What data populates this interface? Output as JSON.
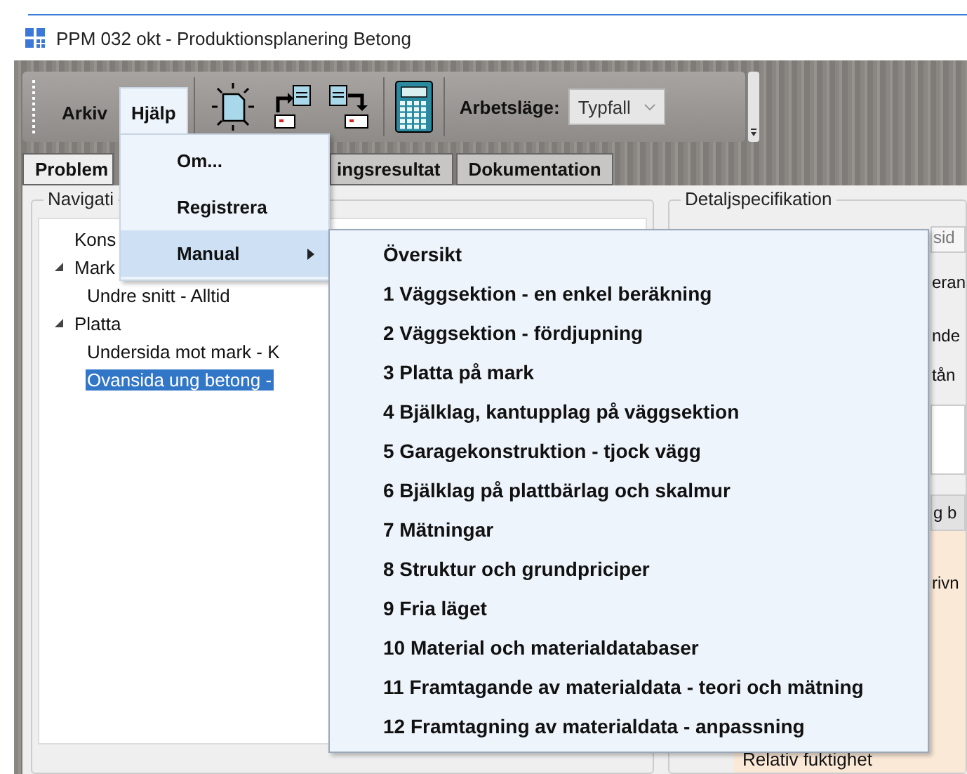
{
  "window": {
    "title": "PPM 032 okt - Produktionsplanering Betong"
  },
  "menubar": [
    {
      "label": "Arkiv",
      "open": false
    },
    {
      "label": "Hjälp",
      "open": true
    }
  ],
  "toolbar": {
    "mode_label": "Arbetsläge:",
    "mode_value": "Typfall",
    "mode_disabled": true
  },
  "tabs": [
    {
      "label": "Problem",
      "selected": true
    },
    {
      "label": "ingsresultat",
      "selected": false
    },
    {
      "label": "Dokumentation",
      "selected": false
    }
  ],
  "navigation": {
    "title": "Navigati",
    "tree": [
      {
        "label": "Kons",
        "selected": false
      },
      {
        "label": "Mark",
        "selected": false,
        "expanded": true,
        "children": [
          {
            "label": "Undre snitt - Alltid",
            "selected": false
          }
        ]
      },
      {
        "label": "Platta",
        "selected": false,
        "expanded": true,
        "children": [
          {
            "label": "Undersida mot mark - K",
            "selected": false
          },
          {
            "label": "Ovansida ung betong -",
            "selected": true
          }
        ]
      }
    ]
  },
  "help_menu": [
    {
      "label": "Om...",
      "selected": false,
      "has_submenu": false
    },
    {
      "label": "Registrera",
      "selected": false,
      "has_submenu": false
    },
    {
      "label": "Manual",
      "selected": true,
      "has_submenu": true
    }
  ],
  "manual_submenu": [
    "Översikt",
    "1 Väggsektion - en enkel beräkning",
    "2 Väggsektion - fördjupning",
    "3 Platta på mark",
    "4 Bjälklag, kantupplag på väggsektion",
    "5 Garagekonstruktion - tjock vägg",
    "6 Bjälklag på plattbärlag och skalmur",
    "7 Mätningar",
    "8 Struktur och grundpriciper",
    "9 Fria läget",
    "10 Material och materialdatabaser",
    "11 Framtagande av materialdata - teori och mätning",
    "12 Framtagning av materialdata - anpassning"
  ],
  "details": {
    "title": "Detaljspecifikation",
    "rows": [
      {
        "kind": "field",
        "text": "sid"
      },
      {
        "kind": "text",
        "text": "eran"
      },
      {
        "kind": "text",
        "text": "nde"
      },
      {
        "kind": "text",
        "text": "tån"
      },
      {
        "kind": "area"
      },
      {
        "kind": "header",
        "text": "g b"
      },
      {
        "kind": "note",
        "text": "rivn"
      }
    ],
    "footer": "Relativ fuktighet"
  }
}
